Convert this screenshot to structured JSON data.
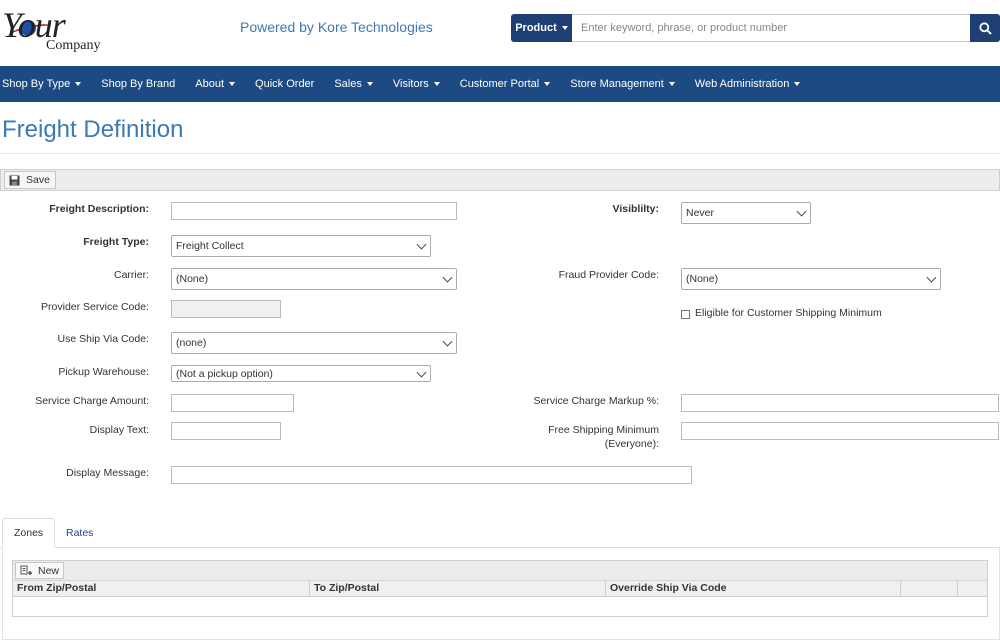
{
  "header": {
    "logo_main": "Your",
    "logo_sub": "Company",
    "powered_by": "Powered by Kore Technologies"
  },
  "search": {
    "scope_label": "Product",
    "placeholder": "Enter keyword, phrase, or product number",
    "icon": "search-icon"
  },
  "nav": {
    "items": [
      {
        "label": "Shop By Type",
        "dropdown": true
      },
      {
        "label": "Shop By Brand",
        "dropdown": false
      },
      {
        "label": "About",
        "dropdown": true
      },
      {
        "label": "Quick Order",
        "dropdown": false
      },
      {
        "label": "Sales",
        "dropdown": true
      },
      {
        "label": "Visitors",
        "dropdown": true
      },
      {
        "label": "Customer Portal",
        "dropdown": true
      },
      {
        "label": "Store Management",
        "dropdown": true
      },
      {
        "label": "Web Administration",
        "dropdown": true
      }
    ]
  },
  "page": {
    "title": "Freight Definition"
  },
  "toolbar": {
    "save_label": "Save",
    "save_icon": "floppy-disk-icon"
  },
  "form": {
    "freight_description": {
      "label": "Freight Description:",
      "value": ""
    },
    "visibility": {
      "label": "Visiblilty:",
      "value": "Never"
    },
    "freight_type": {
      "label": "Freight Type:",
      "value": "Freight Collect"
    },
    "carrier": {
      "label": "Carrier:",
      "value": "(None)"
    },
    "fraud_provider_code": {
      "label": "Fraud Provider Code:",
      "value": "(None)"
    },
    "provider_service_code": {
      "label": "Provider Service Code:",
      "value": ""
    },
    "eligible_min": {
      "label": "Eligible for Customer Shipping Minimum",
      "checked": false
    },
    "use_ship_via_code": {
      "label": "Use Ship Via Code:",
      "value": "(none)"
    },
    "pickup_warehouse": {
      "label": "Pickup Warehouse:",
      "value": "(Not a pickup option)"
    },
    "service_charge_amount": {
      "label": "Service Charge Amount:",
      "value": ""
    },
    "service_charge_markup": {
      "label": "Service Charge Markup %:",
      "value": ""
    },
    "display_text": {
      "label": "Display Text:",
      "value": ""
    },
    "free_shipping_min": {
      "label_line1": "Free Shipping Minimum",
      "label_line2": "(Everyone):",
      "value": ""
    },
    "display_message": {
      "label": "Display Message:",
      "value": ""
    }
  },
  "tabs": [
    {
      "label": "Zones",
      "active": true
    },
    {
      "label": "Rates",
      "active": false
    }
  ],
  "grid": {
    "new_label": "New",
    "new_icon": "new-record-icon",
    "columns": [
      "From Zip/Postal",
      "To Zip/Postal",
      "Override Ship Via Code",
      ""
    ],
    "rows": []
  },
  "colors": {
    "nav_bg": "#1e4a84",
    "search_bg": "#1e3f73",
    "title_color": "#3b7ab5"
  }
}
